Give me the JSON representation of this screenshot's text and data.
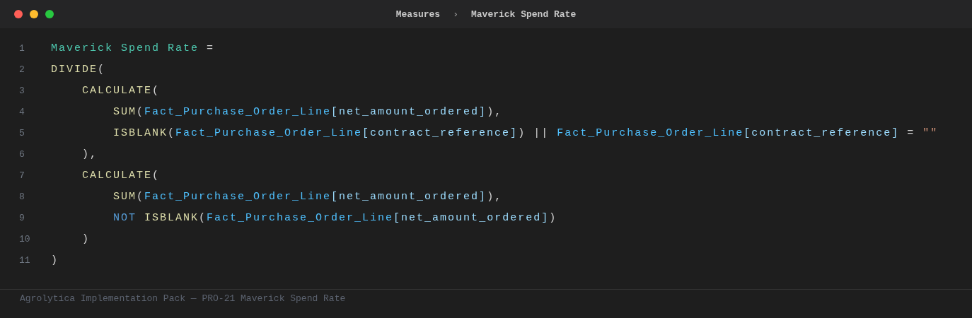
{
  "window": {
    "breadcrumb": [
      {
        "label": "Measures"
      },
      {
        "label": "›",
        "kind": "separator"
      },
      {
        "label": "Maverick Spend Rate"
      }
    ]
  },
  "editor": {
    "lines": [
      {
        "number": "1",
        "tokens": [
          {
            "kind": "measure",
            "text": "Maverick Spend Rate"
          },
          {
            "kind": "operator",
            "text": " ="
          }
        ]
      },
      {
        "number": "2",
        "tokens": [
          {
            "kind": "function",
            "text": "DIVIDE"
          },
          {
            "kind": "punct",
            "text": "("
          }
        ]
      },
      {
        "number": "3",
        "tokens": [
          {
            "kind": "function",
            "text": "    CALCULATE"
          },
          {
            "kind": "punct",
            "text": "("
          }
        ]
      },
      {
        "number": "4",
        "tokens": [
          {
            "kind": "function",
            "text": "        SUM"
          },
          {
            "kind": "punct",
            "text": "("
          },
          {
            "kind": "table",
            "text": "Fact_Purchase_Order_Line"
          },
          {
            "kind": "column",
            "text": "[net_amount_ordered]"
          },
          {
            "kind": "punct",
            "text": "),"
          }
        ]
      },
      {
        "number": "5",
        "tokens": [
          {
            "kind": "function",
            "text": "        ISBLANK"
          },
          {
            "kind": "punct",
            "text": "("
          },
          {
            "kind": "table",
            "text": "Fact_Purchase_Order_Line"
          },
          {
            "kind": "column",
            "text": "[contract_reference]"
          },
          {
            "kind": "punct",
            "text": ")"
          },
          {
            "kind": "operator",
            "text": " || "
          },
          {
            "kind": "table",
            "text": "Fact_Purchase_Order_Line"
          },
          {
            "kind": "column",
            "text": "[contract_reference]"
          },
          {
            "kind": "operator",
            "text": " = "
          },
          {
            "kind": "string",
            "text": "\"\""
          }
        ]
      },
      {
        "number": "6",
        "tokens": [
          {
            "kind": "punct",
            "text": "    ),"
          }
        ]
      },
      {
        "number": "7",
        "tokens": [
          {
            "kind": "function",
            "text": "    CALCULATE"
          },
          {
            "kind": "punct",
            "text": "("
          }
        ]
      },
      {
        "number": "8",
        "tokens": [
          {
            "kind": "function",
            "text": "        SUM"
          },
          {
            "kind": "punct",
            "text": "("
          },
          {
            "kind": "table",
            "text": "Fact_Purchase_Order_Line"
          },
          {
            "kind": "column",
            "text": "[net_amount_ordered]"
          },
          {
            "kind": "punct",
            "text": "),"
          }
        ]
      },
      {
        "number": "9",
        "tokens": [
          {
            "kind": "keyword",
            "text": "        NOT"
          },
          {
            "kind": "function",
            "text": " ISBLANK"
          },
          {
            "kind": "punct",
            "text": "("
          },
          {
            "kind": "table",
            "text": "Fact_Purchase_Order_Line"
          },
          {
            "kind": "column",
            "text": "[net_amount_ordered]"
          },
          {
            "kind": "punct",
            "text": ")"
          }
        ]
      },
      {
        "number": "10",
        "tokens": [
          {
            "kind": "punct",
            "text": "    )"
          }
        ]
      },
      {
        "number": "11",
        "tokens": [
          {
            "kind": "punct",
            "text": ")"
          }
        ]
      }
    ]
  },
  "footer": {
    "text": "Agrolytica Implementation Pack — PRO-21 Maverick Spend Rate"
  }
}
